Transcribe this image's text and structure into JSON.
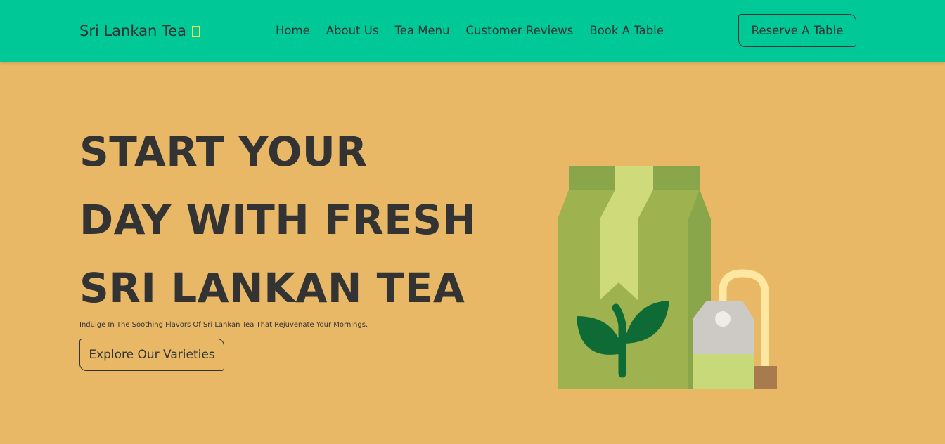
{
  "navbar": {
    "brand": "Sri Lankan Tea",
    "brand_icon": "leaf-icon",
    "links": [
      "Home",
      "About Us",
      "Tea Menu",
      "Customer Reviews",
      "Book A Table"
    ],
    "cta": "Reserve A Table"
  },
  "hero": {
    "title_lines": [
      "START YOUR",
      "DAY WITH FRESH",
      "SRI LANKAN TEA"
    ],
    "subtitle": "Indulge In The Soothing Flavors Of Sri Lankan Tea That Rejuvenate Your Mornings.",
    "cta": "Explore Our Varieties",
    "illustration": "tea-package-and-teabag-illustration"
  },
  "colors": {
    "navbar_bg": "#00c897",
    "page_bg": "#e8b867",
    "text": "#333333",
    "package_green": "#9eb350",
    "leaf_dark": "#0f6b36",
    "ribbon": "#cfdb7b"
  }
}
